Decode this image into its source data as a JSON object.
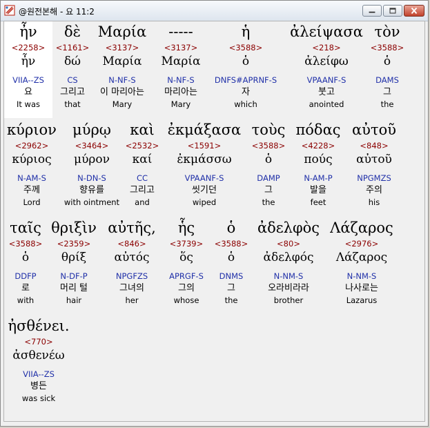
{
  "window": {
    "title": "@원전본해 - 요 11:2"
  },
  "rows": [
    {
      "words": [
        {
          "greek": "ἦν",
          "strong": "<2258>",
          "lemma": "ἦν",
          "parse": "VIIA--ZS",
          "korean": "요",
          "english": "It was",
          "selected": true
        },
        {
          "greek": "δὲ",
          "strong": "<1161>",
          "lemma": "δώ",
          "parse": "CS",
          "korean": "그리고",
          "english": "that"
        },
        {
          "greek": "Μαρία",
          "strong": "<3137>",
          "lemma": "Μαρία",
          "parse": "N-NF-S",
          "korean": "이 마리아는",
          "english": "Mary"
        },
        {
          "greek": "-----",
          "strong": "<3137>",
          "lemma": "Μαρία",
          "parse": "N-NF-S",
          "korean": "마리아는",
          "english": "Mary"
        },
        {
          "greek": "ἡ",
          "strong": "<3588>",
          "lemma": "ὁ",
          "parse": "DNFS#APRNF-S",
          "korean": "자",
          "english": "which"
        },
        {
          "greek": "ἀλείψασα",
          "strong": "<218>",
          "lemma": "ἀλείφω",
          "parse": "VPAANF-S",
          "korean": "붓고",
          "english": "anointed"
        },
        {
          "greek": "τὸν",
          "strong": "<3588>",
          "lemma": "ὁ",
          "parse": "DAMS",
          "korean": "그",
          "english": "the"
        }
      ]
    },
    {
      "words": [
        {
          "greek": "κύριον",
          "strong": "<2962>",
          "lemma": "κύριος",
          "parse": "N-AM-S",
          "korean": "주께",
          "english": "Lord"
        },
        {
          "greek": "μύρῳ",
          "strong": "<3464>",
          "lemma": "μύρον",
          "parse": "N-DN-S",
          "korean": "향유를",
          "english": "with ointment"
        },
        {
          "greek": "καὶ",
          "strong": "<2532>",
          "lemma": "καί",
          "parse": "CC",
          "korean": "그리고",
          "english": "and"
        },
        {
          "greek": "ἐκμάξασα",
          "strong": "<1591>",
          "lemma": "ἐκμάσσω",
          "parse": "VPAANF-S",
          "korean": "씻기던",
          "english": "wiped"
        },
        {
          "greek": "τοὺς",
          "strong": "<3588>",
          "lemma": "ὁ",
          "parse": "DAMP",
          "korean": "그",
          "english": "the"
        },
        {
          "greek": "πόδας",
          "strong": "<4228>",
          "lemma": "πούς",
          "parse": "N-AM-P",
          "korean": "발을",
          "english": "feet"
        },
        {
          "greek": "αὐτοῦ",
          "strong": "<848>",
          "lemma": "αὐτοῦ",
          "parse": "NPGMZS",
          "korean": "주의",
          "english": "his"
        }
      ]
    },
    {
      "words": [
        {
          "greek": "ταῖς",
          "strong": "<3588>",
          "lemma": "ὁ",
          "parse": "DDFP",
          "korean": "로",
          "english": "with"
        },
        {
          "greek": "θριξὶν",
          "strong": "<2359>",
          "lemma": "θρίξ",
          "parse": "N-DF-P",
          "korean": "머리 털",
          "english": "hair"
        },
        {
          "greek": "αὐτῆς,",
          "strong": "<846>",
          "lemma": "αὐτός",
          "parse": "NPGFZS",
          "korean": "그녀의",
          "english": "her"
        },
        {
          "greek": "ἧς",
          "strong": "<3739>",
          "lemma": "ὅς",
          "parse": "APRGF-S",
          "korean": "그의",
          "english": "whose"
        },
        {
          "greek": "ὁ",
          "strong": "<3588>",
          "lemma": "ὁ",
          "parse": "DNMS",
          "korean": "그",
          "english": "the"
        },
        {
          "greek": "ἀδελφὸς",
          "strong": "<80>",
          "lemma": "ἀδελφός",
          "parse": "N-NM-S",
          "korean": "오라비라라",
          "english": "brother"
        },
        {
          "greek": "Λάζαρος",
          "strong": "<2976>",
          "lemma": "Λάζαρος",
          "parse": "N-NM-S",
          "korean": "나사로는",
          "english": "Lazarus"
        }
      ]
    },
    {
      "words": [
        {
          "greek": "ἠσθένει.",
          "strong": "<770>",
          "lemma": "ἀσθενέω",
          "parse": "VIIA--ZS",
          "korean": "병든",
          "english": "was sick"
        }
      ]
    }
  ]
}
